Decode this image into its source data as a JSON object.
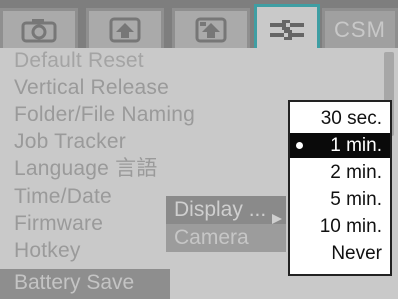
{
  "tabs": [
    {
      "name": "shooting-camera",
      "icon": "camera-icon"
    },
    {
      "name": "playback",
      "icon": "playback-icon"
    },
    {
      "name": "playback-alt",
      "icon": "playback-alt-icon"
    },
    {
      "name": "setup",
      "icon": "wrench-icon",
      "active": true
    },
    {
      "name": "custom",
      "label": "CSM"
    }
  ],
  "menu": {
    "items": [
      "Default Reset",
      "Vertical Release",
      "Folder/File Naming",
      "Job Tracker",
      "Language 言語",
      "Time/Date",
      "Firmware",
      "Hotkey",
      "Battery Save"
    ],
    "selected_index": 8
  },
  "submenu": {
    "items": [
      "Display",
      "Camera"
    ],
    "highlighted": "Display"
  },
  "popup": {
    "options": [
      "30 sec.",
      "1 min.",
      "2 min.",
      "5 min.",
      "10 min.",
      "Never"
    ],
    "selected": "1 min."
  },
  "colors": {
    "active_tab_border": "#3f9ea3",
    "selection_bg": "#0a0a0a"
  }
}
